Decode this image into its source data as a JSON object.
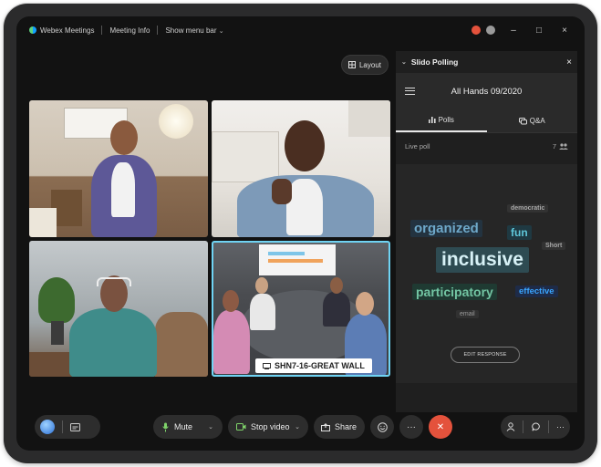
{
  "titlebar": {
    "app_name": "Webex Meetings",
    "meeting_info": "Meeting Info",
    "show_menu_bar": "Show menu bar",
    "badge_colors": [
      "#e4523c",
      "#9a9a9a"
    ],
    "controls": [
      "–",
      "□",
      "×"
    ]
  },
  "layout_button": {
    "label": "Layout"
  },
  "video": {
    "room_label": "SHN7-16-GREAT WALL",
    "active_border_color": "#6fd3f3"
  },
  "slido": {
    "title": "Slido Polling",
    "event_title": "All Hands 09/2020",
    "tabs": [
      {
        "label": "Polls",
        "icon": "bar-chart-icon",
        "active": true
      },
      {
        "label": "Q&A",
        "icon": "chat-bubble-icon",
        "active": false
      }
    ],
    "live_poll_label": "Live poll",
    "participant_count": "7",
    "words": [
      {
        "text": "democratic",
        "color": "#a8a8a8",
        "bg": "#323232"
      },
      {
        "text": "organized",
        "color": "#6ea8c9",
        "bg": "#233340"
      },
      {
        "text": "fun",
        "color": "#5fc6d9",
        "bg": "#1f3942"
      },
      {
        "text": "Short",
        "color": "#a8a8a8",
        "bg": "#323232"
      },
      {
        "text": "inclusive",
        "color": "#d7f1f6",
        "bg": "#2e4b52"
      },
      {
        "text": "participatory",
        "color": "#72c5a3",
        "bg": "#1f3a32"
      },
      {
        "text": "effective",
        "color": "#3aa5ff",
        "bg": "#1e2b48"
      },
      {
        "text": "email",
        "color": "#9a9a9a",
        "bg": "#313131"
      }
    ],
    "edit_response": "EDIT RESPONSE"
  },
  "controls": {
    "mute": "Mute",
    "stop_video": "Stop video",
    "share": "Share",
    "end_call_color": "#e4523c"
  }
}
